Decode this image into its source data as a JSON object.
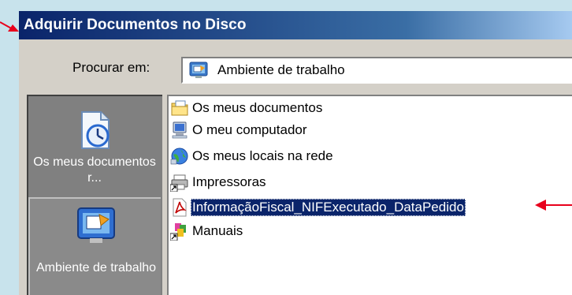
{
  "dialog": {
    "title": "Adquirir Documentos no Disco"
  },
  "look_in": {
    "label": "Procurar em:",
    "value": "Ambiente de trabalho",
    "icon": "desktop-icon"
  },
  "places": [
    {
      "label": "Os meus documentos r...",
      "icon": "my-recent-documents-icon"
    },
    {
      "label": "Ambiente de trabalho",
      "icon": "desktop-icon"
    }
  ],
  "files": [
    {
      "name": "Os meus documentos",
      "icon": "my-documents-folder-icon",
      "selected": false
    },
    {
      "name": "O meu computador",
      "icon": "my-computer-icon",
      "selected": false
    },
    {
      "name": "Os meus locais na rede",
      "icon": "network-places-icon",
      "selected": false
    },
    {
      "name": "Impressoras",
      "icon": "printers-shortcut-icon",
      "selected": false
    },
    {
      "name": "InformaçãoFiscal_NIFExecutado_DataPedido",
      "icon": "pdf-file-icon",
      "selected": true
    },
    {
      "name": "Manuais",
      "icon": "folder-shortcut-icon",
      "selected": false
    }
  ],
  "colors": {
    "annotation_arrow": "#e8001c",
    "selection": "#0a246a",
    "title_start": "#0a246a",
    "title_end": "#a6caf0"
  }
}
